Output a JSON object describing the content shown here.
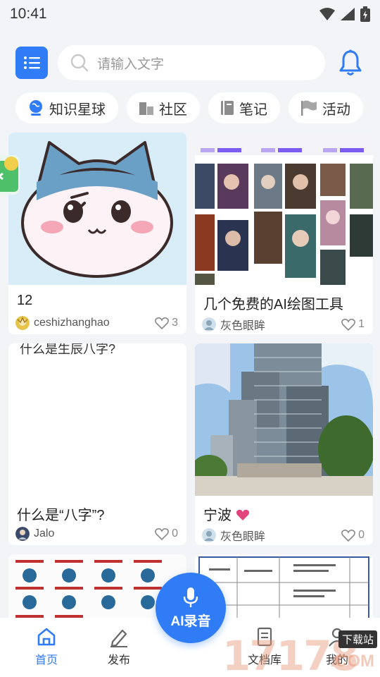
{
  "status": {
    "time": "10:41"
  },
  "search": {
    "placeholder": "请输入文字"
  },
  "categories": [
    {
      "label": "知识星球",
      "icon": "globe-icon"
    },
    {
      "label": "社区",
      "icon": "buildings-icon"
    },
    {
      "label": "笔记",
      "icon": "notebook-icon"
    },
    {
      "label": "活动",
      "icon": "flag-icon"
    }
  ],
  "posts": [
    {
      "title": "12",
      "author": "ceshizhanghao",
      "likes": "3"
    },
    {
      "title": "几个免费的AI绘图工具",
      "author": "灰色眼眸",
      "likes": "1"
    },
    {
      "title": "什么是“八字”?",
      "author": "Jalo",
      "likes": "0",
      "thumb_text": "什么是生辰八字?"
    },
    {
      "title": "宁波",
      "author": "灰色眼眸",
      "likes": "0"
    }
  ],
  "nav": {
    "home": "首页",
    "publish": "发布",
    "ai": "AI录音",
    "docs": "文档库",
    "me": "我的"
  },
  "watermark": {
    "main": "17178",
    "tag": "下载站",
    "suffix": ".COM"
  },
  "colors": {
    "accent": "#2f7cf6",
    "background": "#f2f4f7",
    "heart": "#e0457b"
  }
}
